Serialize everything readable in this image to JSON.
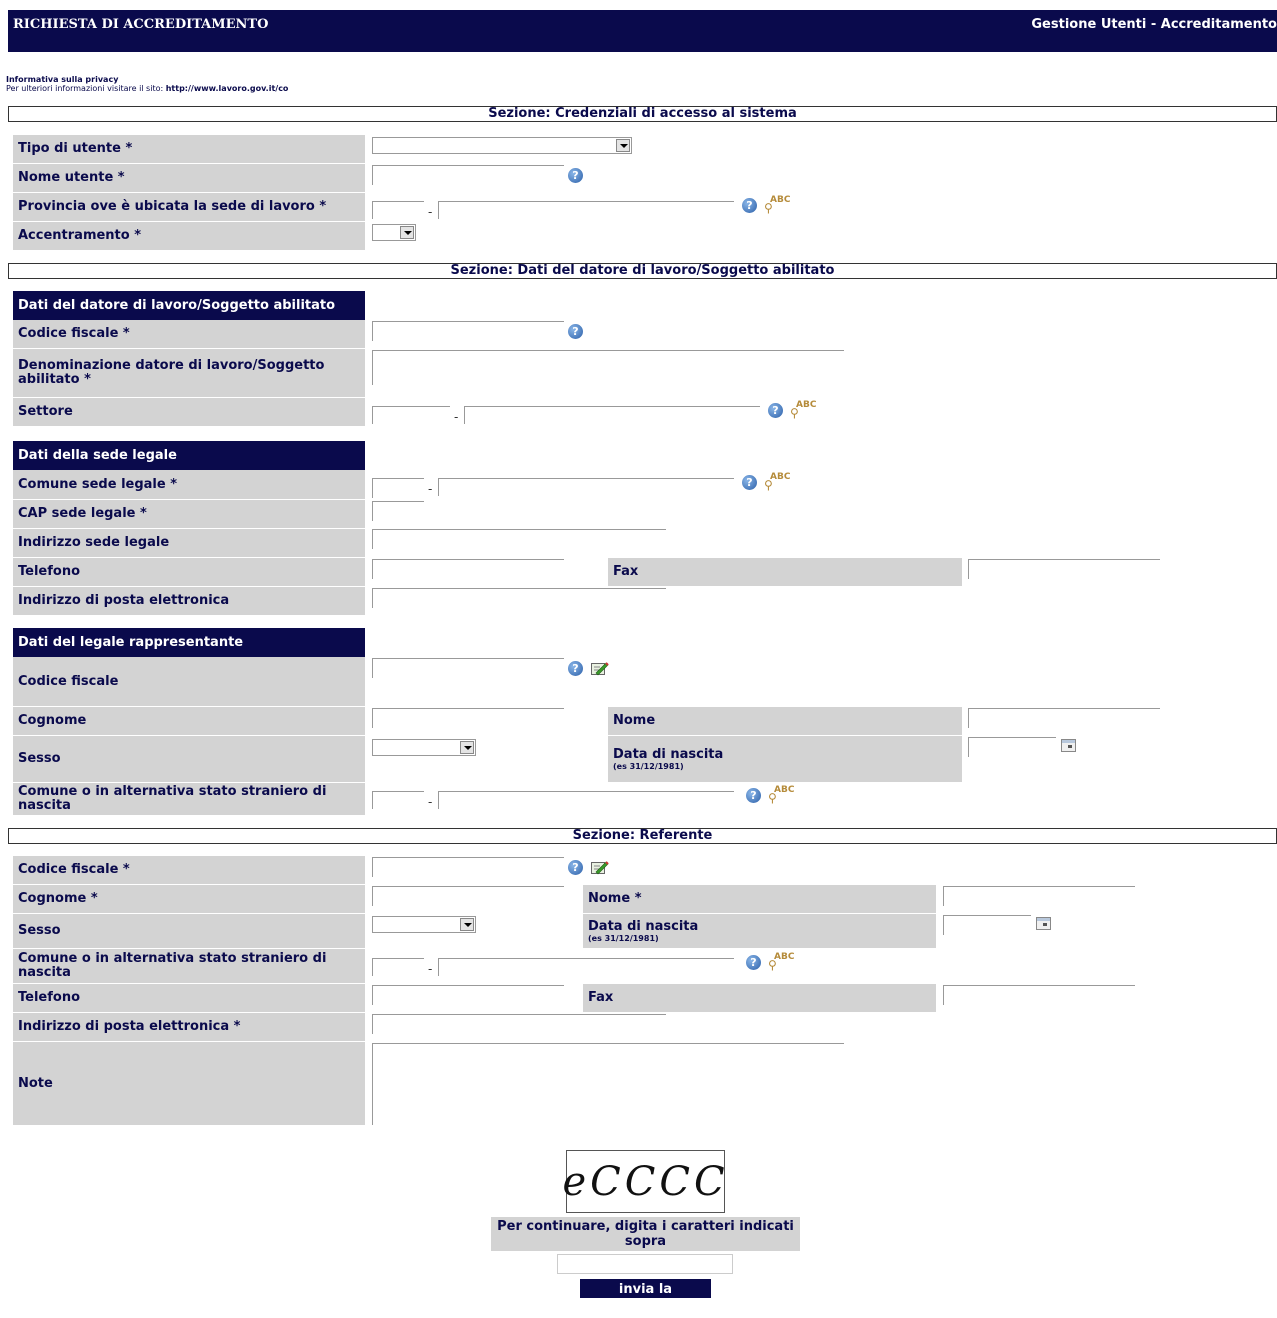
{
  "header": {
    "title": "RICHIESTA DI ACCREDITAMENTO",
    "right": "Gestione Utenti - Accreditamento"
  },
  "privacy": {
    "link": "Informativa sulla privacy",
    "text": "Per ulteriori informazioni visitare il sito:",
    "url": "http://www.lavoro.gov.it/co"
  },
  "sections": {
    "credenziali": "Sezione: Credenziali di accesso al sistema",
    "datore": "Sezione: Dati del datore di lavoro/Soggetto abilitato",
    "referente": "Sezione: Referente"
  },
  "credenziali": {
    "tipo_utente": "Tipo di utente *",
    "nome_utente": "Nome utente *",
    "provincia": "Provincia ove è ubicata la sede di lavoro *",
    "accentramento": "Accentramento *"
  },
  "datore": {
    "subheader": "Dati del datore di lavoro/Soggetto abilitato",
    "codice_fiscale": "Codice fiscale *",
    "denominazione": "Denominazione datore di lavoro/Soggetto abilitato *",
    "settore": "Settore"
  },
  "sede": {
    "subheader": "Dati della sede legale",
    "comune": "Comune sede legale *",
    "cap": "CAP sede legale *",
    "indirizzo": "Indirizzo sede legale",
    "telefono": "Telefono",
    "fax": "Fax",
    "email": "Indirizzo di posta elettronica"
  },
  "legale": {
    "subheader": "Dati del legale rappresentante",
    "codice_fiscale": "Codice fiscale",
    "cognome": "Cognome",
    "nome": "Nome",
    "sesso": "Sesso",
    "data_nascita": "Data di nascita",
    "data_hint": "(es 31/12/1981)",
    "comune_nascita": "Comune o in alternativa stato straniero di nascita"
  },
  "referente": {
    "codice_fiscale": "Codice fiscale *",
    "cognome": "Cognome *",
    "nome": "Nome *",
    "sesso": "Sesso",
    "data_nascita": "Data di nascita",
    "data_hint": "(es 31/12/1981)",
    "comune_nascita": "Comune o in alternativa stato straniero di nascita",
    "telefono": "Telefono",
    "fax": "Fax",
    "email": "Indirizzo di posta elettronica *",
    "note": "Note"
  },
  "captcha": {
    "text": "eCCCC",
    "label": "Per continuare, digita i caratteri indicati sopra",
    "submit": "invia la richiesta"
  },
  "colors": {
    "navy": "#0a0a4c",
    "label_bg": "#d3d3d3"
  }
}
